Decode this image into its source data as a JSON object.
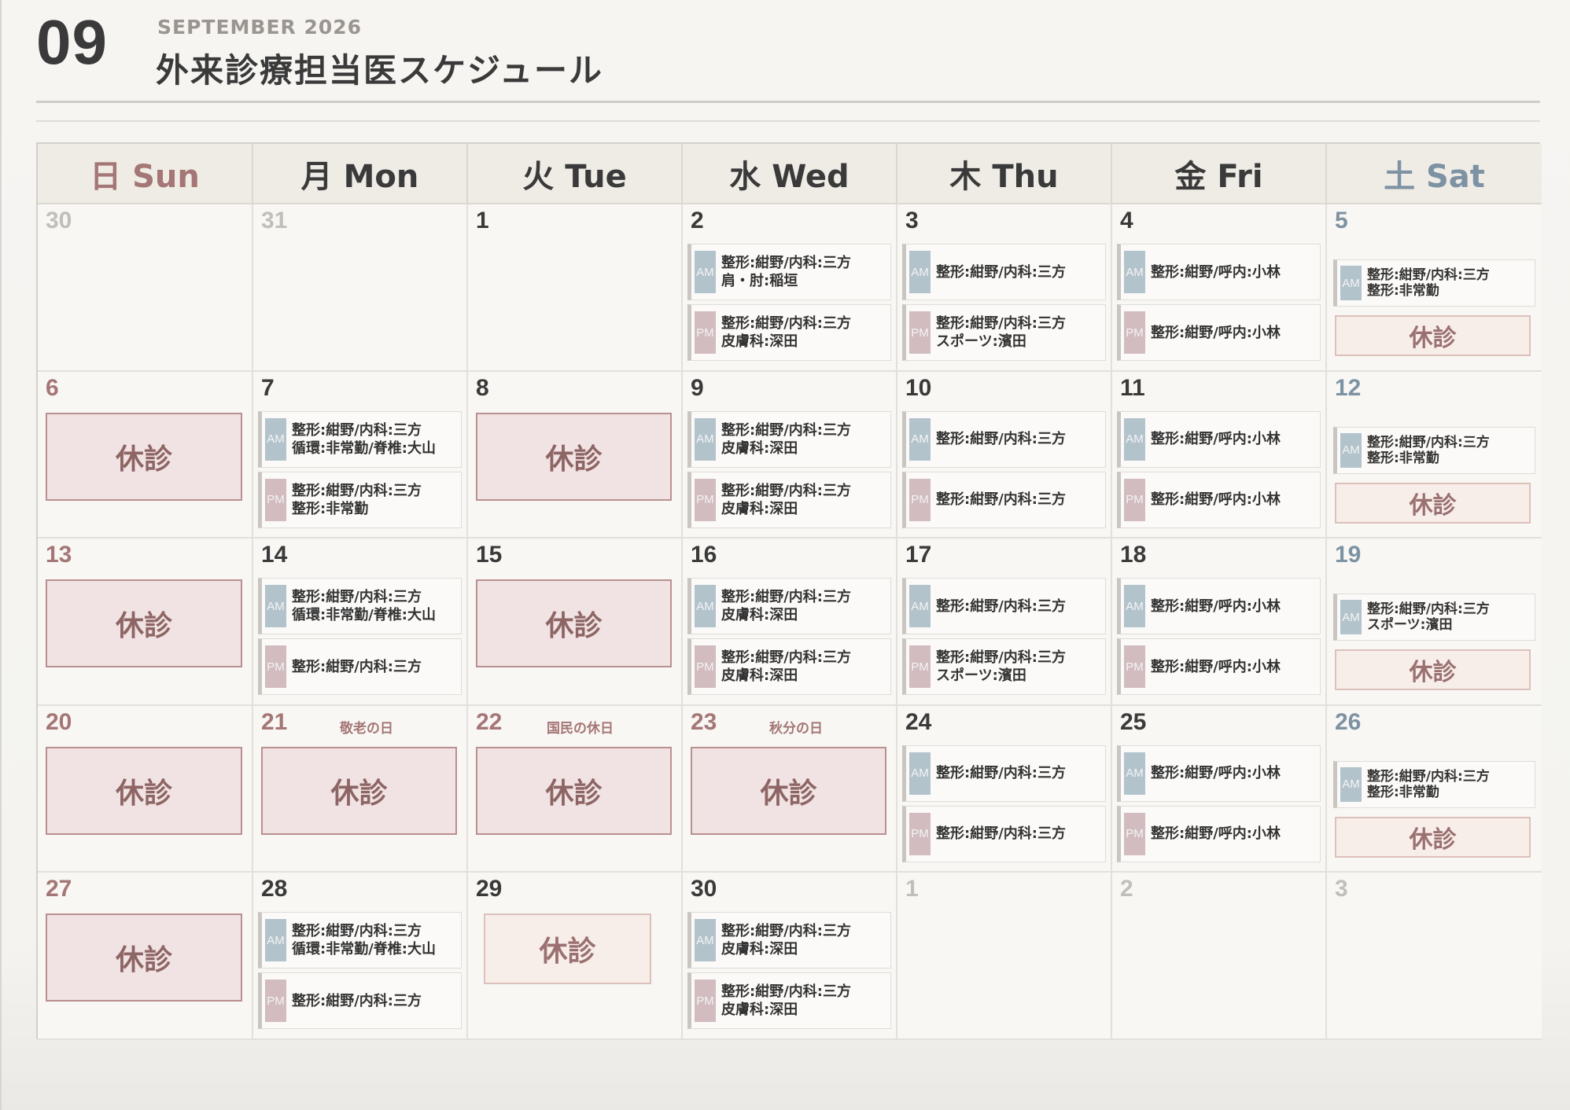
{
  "header": {
    "month_number": "09",
    "month_label": "SEPTEMBER 2026",
    "title": "外来診療担当医スケジュール"
  },
  "weekdays": [
    {
      "label": "日 Sun",
      "kind": "sun"
    },
    {
      "label": "月 Mon",
      "kind": "wk"
    },
    {
      "label": "火 Tue",
      "kind": "wk"
    },
    {
      "label": "水 Wed",
      "kind": "wk"
    },
    {
      "label": "木 Thu",
      "kind": "wk"
    },
    {
      "label": "金 Fri",
      "kind": "wk"
    },
    {
      "label": "土 Sat",
      "kind": "sat"
    }
  ],
  "labels": {
    "am": "AM",
    "pm": "PM",
    "closed": "休診"
  },
  "weeks": [
    [
      {
        "day": "30",
        "muted": true
      },
      {
        "day": "31",
        "muted": true
      },
      {
        "day": "1"
      },
      {
        "day": "2",
        "am": [
          "整形:紺野/内科:三方",
          "肩・肘:稲垣"
        ],
        "pm": [
          "整形:紺野/内科:三方",
          "皮膚科:深田"
        ]
      },
      {
        "day": "3",
        "am": [
          "整形:紺野/内科:三方"
        ],
        "pm": [
          "整形:紺野/内科:三方",
          "スポーツ:濱田"
        ]
      },
      {
        "day": "4",
        "am": [
          "整形:紺野/呼内:小林"
        ],
        "pm": [
          "整形:紺野/呼内:小林"
        ]
      },
      {
        "day": "5",
        "am": [
          "整形:紺野/内科:三方",
          "整形:非常勤"
        ],
        "closed_pm": true
      }
    ],
    [
      {
        "day": "6",
        "closed": true
      },
      {
        "day": "7",
        "am": [
          "整形:紺野/内科:三方",
          "循環:非常勤/脊椎:大山"
        ],
        "pm": [
          "整形:紺野/内科:三方",
          "整形:非常勤"
        ]
      },
      {
        "day": "8",
        "closed": true
      },
      {
        "day": "9",
        "am": [
          "整形:紺野/内科:三方",
          "皮膚科:深田"
        ],
        "pm": [
          "整形:紺野/内科:三方",
          "皮膚科:深田"
        ]
      },
      {
        "day": "10",
        "am": [
          "整形:紺野/内科:三方"
        ],
        "pm": [
          "整形:紺野/内科:三方"
        ]
      },
      {
        "day": "11",
        "am": [
          "整形:紺野/呼内:小林"
        ],
        "pm": [
          "整形:紺野/呼内:小林"
        ]
      },
      {
        "day": "12",
        "am": [
          "整形:紺野/内科:三方",
          "整形:非常勤"
        ],
        "closed_pm": true
      }
    ],
    [
      {
        "day": "13",
        "closed": true
      },
      {
        "day": "14",
        "am": [
          "整形:紺野/内科:三方",
          "循環:非常勤/脊椎:大山"
        ],
        "pm": [
          "整形:紺野/内科:三方"
        ]
      },
      {
        "day": "15",
        "closed": true
      },
      {
        "day": "16",
        "am": [
          "整形:紺野/内科:三方",
          "皮膚科:深田"
        ],
        "pm": [
          "整形:紺野/内科:三方",
          "皮膚科:深田"
        ]
      },
      {
        "day": "17",
        "am": [
          "整形:紺野/内科:三方"
        ],
        "pm": [
          "整形:紺野/内科:三方",
          "スポーツ:濱田"
        ]
      },
      {
        "day": "18",
        "am": [
          "整形:紺野/呼内:小林"
        ],
        "pm": [
          "整形:紺野/呼内:小林"
        ]
      },
      {
        "day": "19",
        "am": [
          "整形:紺野/内科:三方",
          "スポーツ:濱田"
        ],
        "closed_pm": true
      }
    ],
    [
      {
        "day": "20",
        "closed": true
      },
      {
        "day": "21",
        "closed": true,
        "holiday": "敬老の日"
      },
      {
        "day": "22",
        "closed": true,
        "holiday": "国民の休日"
      },
      {
        "day": "23",
        "closed": true,
        "holiday": "秋分の日"
      },
      {
        "day": "24",
        "am": [
          "整形:紺野/内科:三方"
        ],
        "pm": [
          "整形:紺野/内科:三方"
        ]
      },
      {
        "day": "25",
        "am": [
          "整形:紺野/呼内:小林"
        ],
        "pm": [
          "整形:紺野/呼内:小林"
        ]
      },
      {
        "day": "26",
        "am": [
          "整形:紺野/内科:三方",
          "整形:非常勤"
        ],
        "closed_pm": true
      }
    ],
    [
      {
        "day": "27",
        "closed": true
      },
      {
        "day": "28",
        "am": [
          "整形:紺野/内科:三方",
          "循環:非常勤/脊椎:大山"
        ],
        "pm": [
          "整形:紺野/内科:三方"
        ]
      },
      {
        "day": "29",
        "closed_light": true
      },
      {
        "day": "30",
        "am": [
          "整形:紺野/内科:三方",
          "皮膚科:深田"
        ],
        "pm": [
          "整形:紺野/内科:三方",
          "皮膚科:深田"
        ]
      },
      {
        "day": "1",
        "muted": true
      },
      {
        "day": "2",
        "muted": true
      },
      {
        "day": "3",
        "muted": true
      }
    ]
  ]
}
